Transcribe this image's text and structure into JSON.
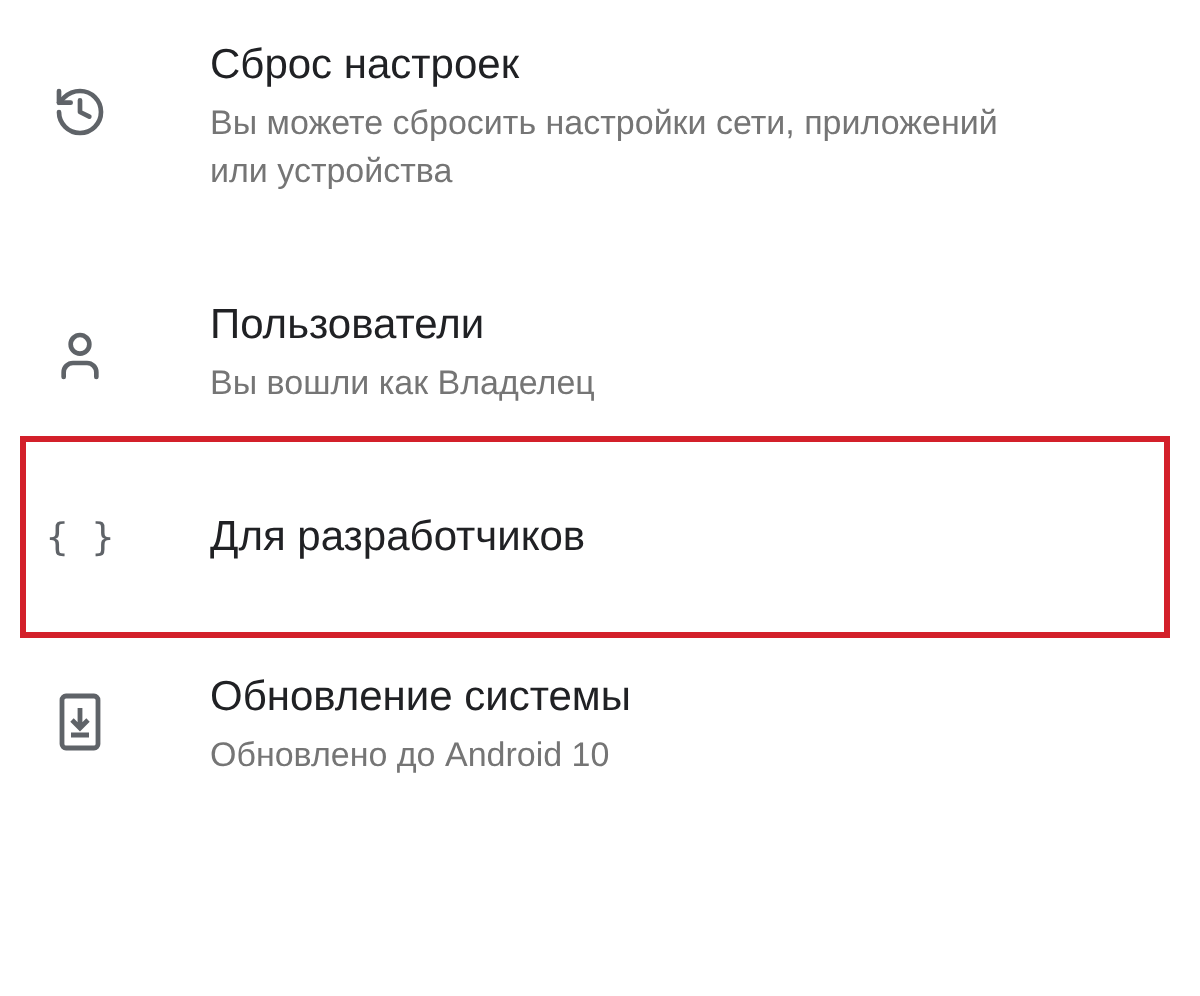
{
  "settings_items": [
    {
      "kind": "history",
      "title": "Сброс настроек",
      "subtitle": "Вы можете сбросить настройки сети, приложений или устройства",
      "highlighted": false
    },
    {
      "kind": "person",
      "title": "Пользователи",
      "subtitle": "Вы вошли как Владелец",
      "highlighted": false
    },
    {
      "kind": "braces",
      "icon_text": "{ }",
      "title": "Для разработчиков",
      "highlighted": true
    },
    {
      "kind": "update",
      "title": "Обновление системы",
      "subtitle": "Обновлено до Android 10",
      "highlighted": false
    }
  ]
}
